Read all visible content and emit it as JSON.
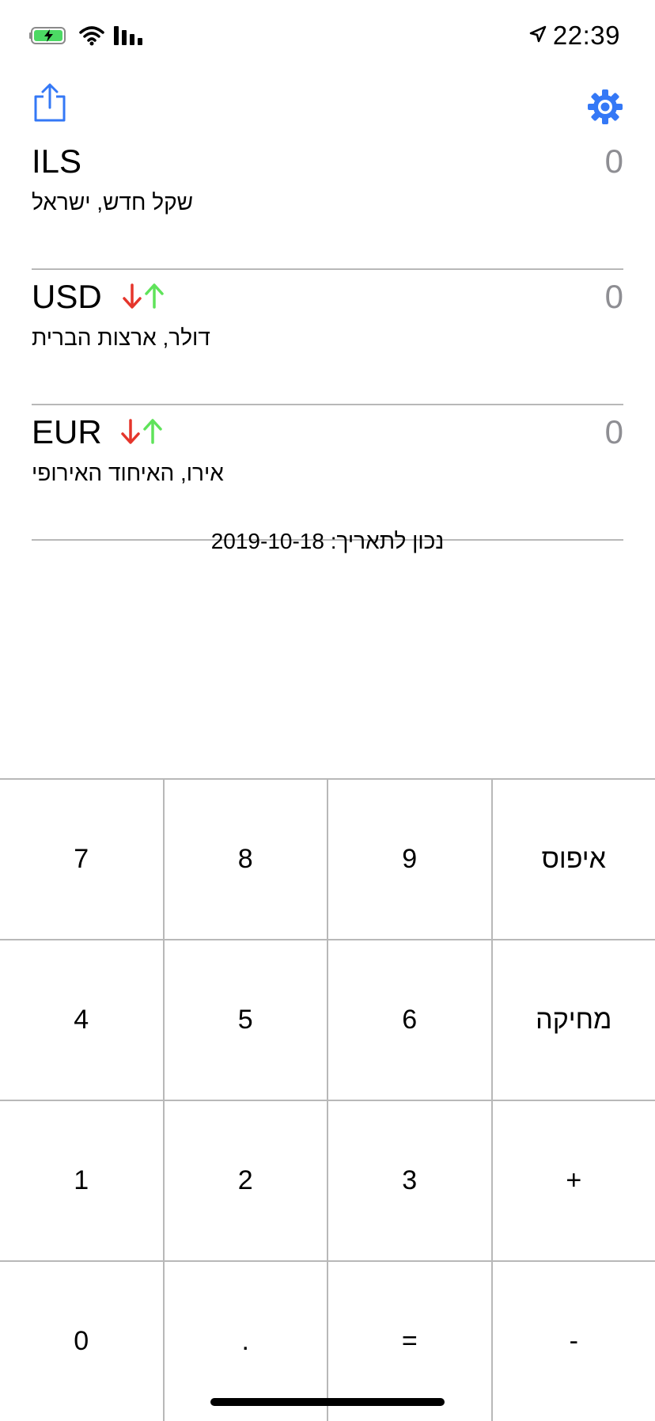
{
  "status_bar": {
    "time": "22:39",
    "icons": [
      "battery-charging-icon",
      "wifi-icon",
      "cellular-signal-icon",
      "location-arrow-icon"
    ]
  },
  "toolbar": {
    "share_icon": "share-icon",
    "settings_icon": "gear-icon",
    "accent_color": "#3478f6"
  },
  "currencies": [
    {
      "code": "ILS",
      "name": "שקל חדש, ישראל",
      "value": "0",
      "show_arrows": false
    },
    {
      "code": "USD",
      "name": "דולר, ארצות הברית",
      "value": "0",
      "show_arrows": true
    },
    {
      "code": "EUR",
      "name": "אירו, האיחוד האירופי",
      "value": "0",
      "show_arrows": true
    }
  ],
  "arrow_colors": {
    "down": "#e5352b",
    "up": "#5fe35a"
  },
  "rate_date": "נכון לתאריך: 2019-10-18",
  "keypad": {
    "rows": [
      [
        "7",
        "8",
        "9",
        "איפוס"
      ],
      [
        "4",
        "5",
        "6",
        "מחיקה"
      ],
      [
        "1",
        "2",
        "3",
        "+"
      ],
      [
        "0",
        ".",
        "=",
        "-"
      ]
    ]
  }
}
